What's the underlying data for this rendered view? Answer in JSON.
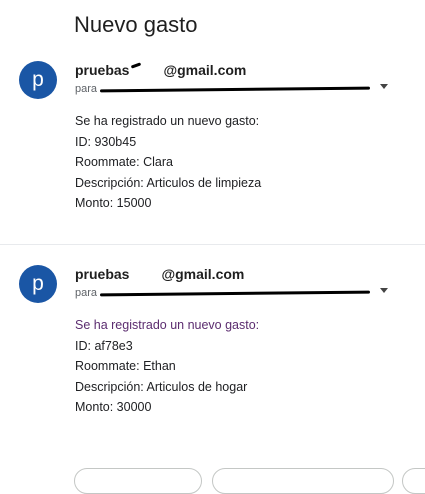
{
  "subject": "Nuevo gasto",
  "messages": [
    {
      "avatar_letter": "p",
      "sender_prefix": "pruebas",
      "sender_domain": "@gmail.com",
      "recipients_prefix": "para",
      "body": [
        "Se ha registrado un nuevo gasto:",
        "ID: 930b45",
        "Roommate: Clara",
        "Descripción: Articulos de limpieza",
        "Monto: 15000"
      ]
    },
    {
      "avatar_letter": "p",
      "sender_prefix": "pruebas",
      "sender_domain": "@gmail.com",
      "recipients_prefix": "para",
      "body": [
        "Se ha registrado un nuevo gasto:",
        "ID: af78e3",
        "Roommate: Ethan",
        "Descripción: Articulos de hogar",
        "Monto: 30000"
      ]
    }
  ],
  "colors": {
    "avatar": "#1a56a5",
    "highlight_line": "#5b2c6f"
  },
  "icons": [
    "chevron-down-icon"
  ]
}
